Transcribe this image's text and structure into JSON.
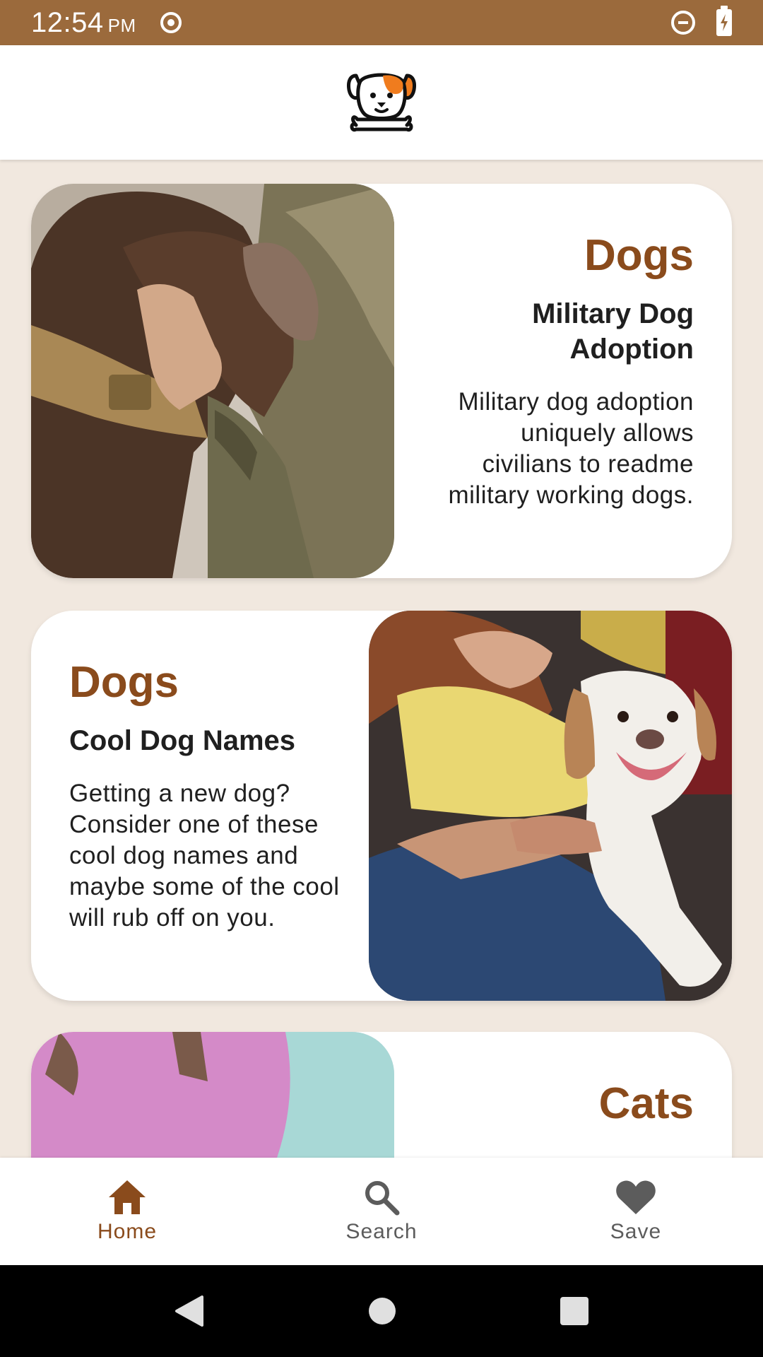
{
  "status_bar": {
    "time": "12:54",
    "ampm": "PM"
  },
  "header": {
    "logo_icon": "dog-logo-icon"
  },
  "cards": [
    {
      "category": "Dogs",
      "title": "Military Dog Adoption",
      "description": "Military dog adoption uniquely allows civilians to readme military working dogs.",
      "image": "soldier-hugging-brown-dog"
    },
    {
      "category": "Dogs",
      "title": "Cool Dog Names",
      "description": "Getting a new dog? Consider one of these cool dog names and maybe some of the cool will rub off on you.",
      "image": "woman-with-beagle"
    },
    {
      "category": "Cats",
      "image": "person-in-pink-shirt"
    }
  ],
  "bottom_nav": {
    "items": [
      {
        "label": "Home",
        "icon": "home-icon",
        "active": true
      },
      {
        "label": "Search",
        "icon": "search-icon",
        "active": false
      },
      {
        "label": "Save",
        "icon": "heart-icon",
        "active": false
      }
    ]
  },
  "colors": {
    "status_bar": "#9b6a3c",
    "accent": "#8a4b1c",
    "background": "#f1e8df"
  }
}
